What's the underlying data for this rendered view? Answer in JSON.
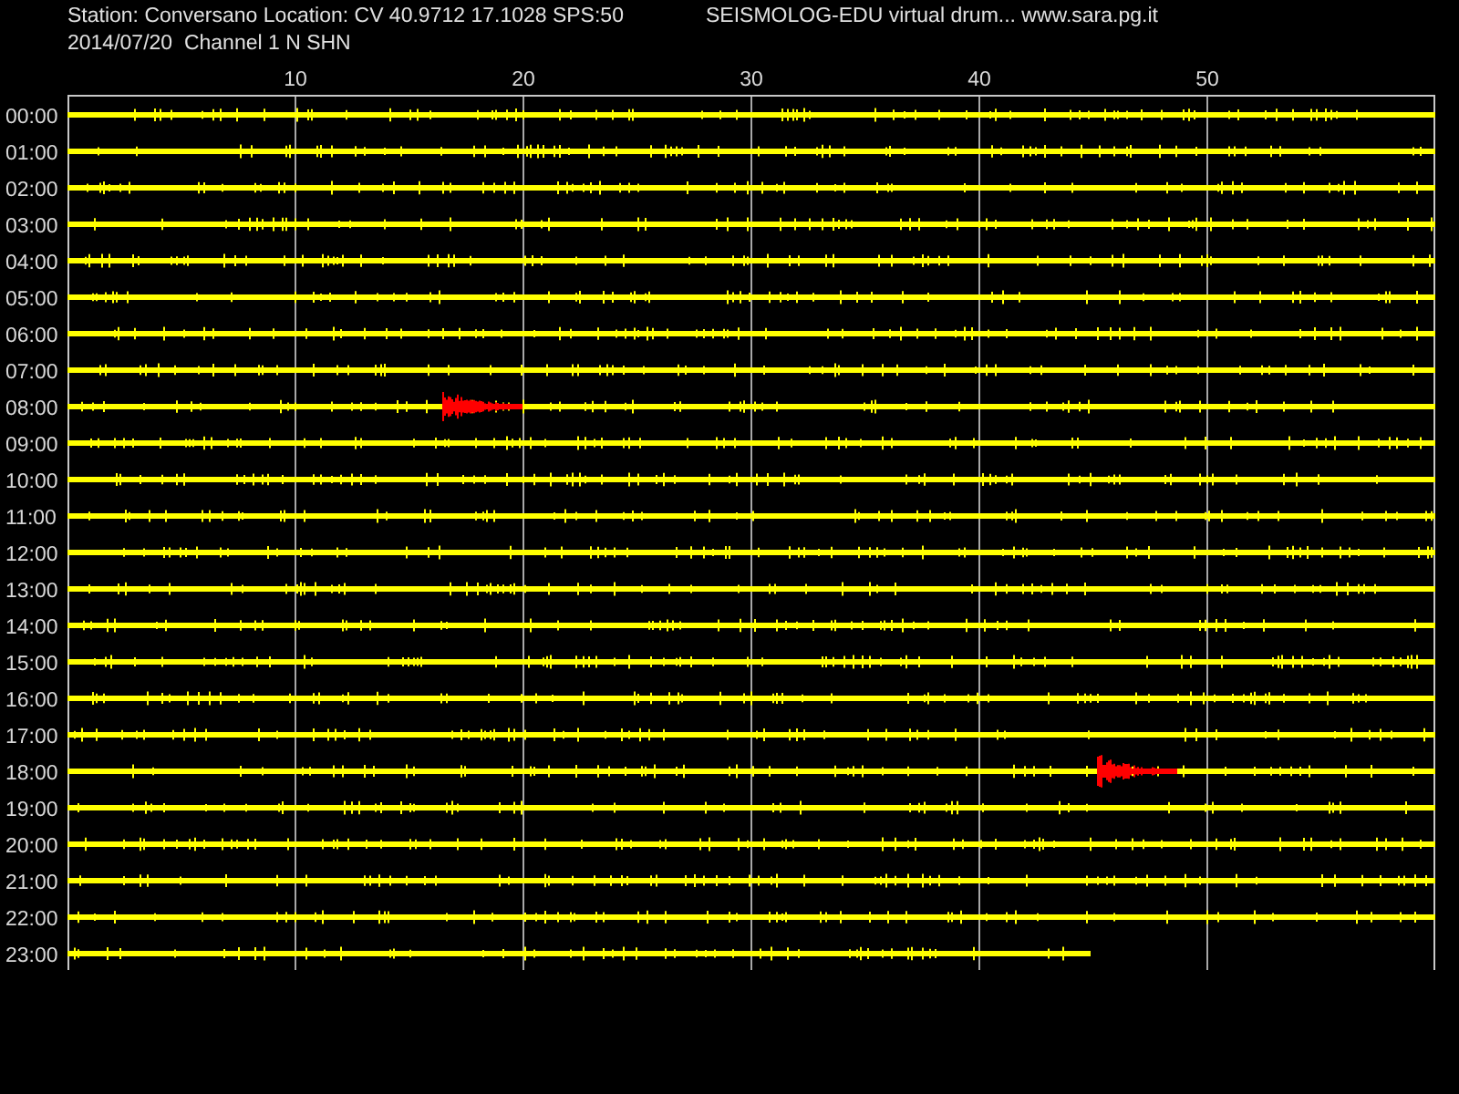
{
  "header": {
    "station_line": "Station: Conversano Location: CV 40.9712 17.1028 SPS:50",
    "date_line": "2014/07/20  Channel 1 N SHN",
    "app_line": "SEISMOLOG-EDU virtual drum... www.sara.pg.it"
  },
  "axis_ticks": [
    "10",
    "20",
    "30",
    "40",
    "50"
  ],
  "rows": [
    {
      "label": "00:00",
      "kind": "trace"
    },
    {
      "label": "01:00",
      "kind": "trace"
    },
    {
      "label": "02:00",
      "kind": "trace"
    },
    {
      "label": "03:00",
      "kind": "trace"
    },
    {
      "label": "04:00",
      "kind": "trace"
    },
    {
      "label": "05:00",
      "kind": "trace"
    },
    {
      "label": "06:00",
      "kind": "trace"
    },
    {
      "label": "07:00",
      "kind": "trace"
    },
    {
      "label": "08:00",
      "kind": "event"
    },
    {
      "label": "09:00",
      "kind": "trace"
    },
    {
      "label": "10:00",
      "kind": "trace"
    },
    {
      "label": "11:00",
      "kind": "trace"
    },
    {
      "label": "12:00",
      "kind": "trace"
    },
    {
      "label": "13:00",
      "kind": "trace"
    },
    {
      "label": "14:00",
      "kind": "trace"
    },
    {
      "label": "15:00",
      "kind": "trace"
    },
    {
      "label": "16:00",
      "kind": "trace"
    },
    {
      "label": "17:00",
      "kind": "trace"
    },
    {
      "label": "18:00",
      "kind": "event"
    },
    {
      "label": "19:00",
      "kind": "trace"
    },
    {
      "label": "20:00",
      "kind": "trace"
    },
    {
      "label": "21:00",
      "kind": "trace"
    },
    {
      "label": "22:00",
      "kind": "trace"
    },
    {
      "label": "23:00",
      "kind": "partial"
    }
  ]
}
